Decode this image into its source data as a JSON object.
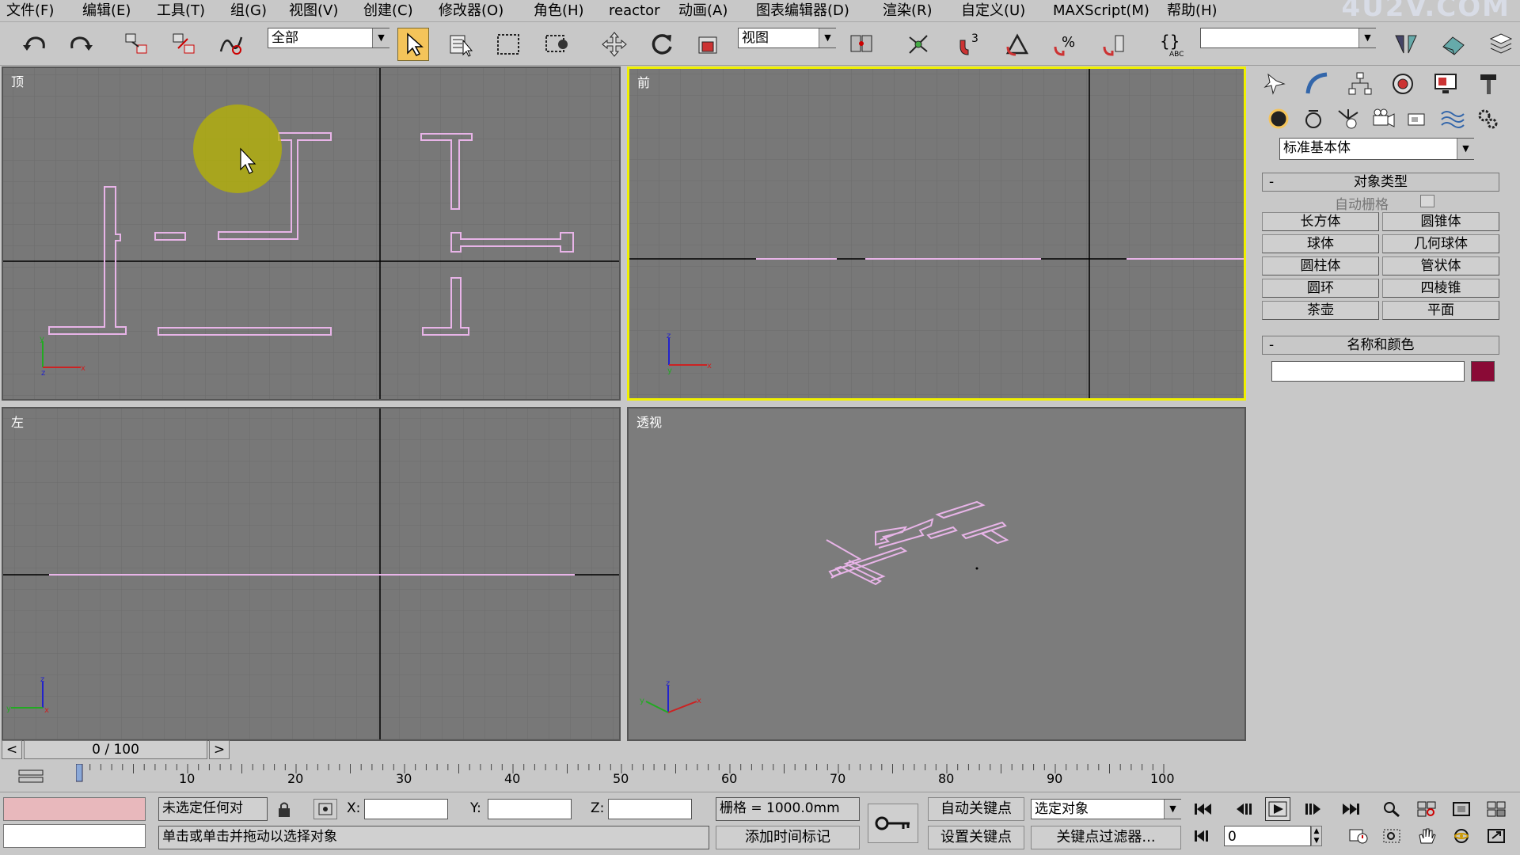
{
  "menu": [
    "文件(F)",
    "编辑(E)",
    "工具(T)",
    "组(G)",
    "视图(V)",
    "创建(C)",
    "修改器(O)",
    "角色(H)",
    "reactor",
    "动画(A)",
    "图表编辑器(D)",
    "渲染(R)",
    "自定义(U)",
    "MAXScript(M)",
    "帮助(H)"
  ],
  "watermark": "4U2V.COM",
  "toolbar": {
    "selection_filter": "全部",
    "ref_coord": "视图"
  },
  "viewports": {
    "top": {
      "label": "顶"
    },
    "front": {
      "label": "前"
    },
    "left": {
      "label": "左"
    },
    "perspective": {
      "label": "透视"
    }
  },
  "command_panel": {
    "category_dropdown": "标准基本体",
    "object_type": {
      "title": "对象类型",
      "autogrid_label": "自动栅格",
      "buttons": [
        "长方体",
        "圆锥体",
        "球体",
        "几何球体",
        "圆柱体",
        "管状体",
        "圆环",
        "四棱锥",
        "茶壶",
        "平面"
      ]
    },
    "name_color": {
      "title": "名称和颜色",
      "name_value": "",
      "color": "#8a0a36"
    },
    "collapse_symbol": "-"
  },
  "timeline": {
    "frame_display": "0 / 100",
    "prev": "<",
    "next": ">",
    "ticks": [
      "10",
      "20",
      "30",
      "40",
      "50",
      "60",
      "70",
      "80",
      "90",
      "100"
    ]
  },
  "status": {
    "selection_info": "未选定任何对",
    "prompt": "单击或单击并拖动以选择对象",
    "x_label": "X:",
    "y_label": "Y:",
    "z_label": "Z:",
    "x_value": "",
    "y_value": "",
    "z_value": "",
    "grid": "栅格 = 1000.0mm",
    "add_time_tag": "添加时间标记",
    "auto_key": "自动关键点",
    "set_key": "设置关键点",
    "key_mode": "选定对象",
    "key_filters": "关键点过滤器...",
    "frame_field": "0"
  }
}
